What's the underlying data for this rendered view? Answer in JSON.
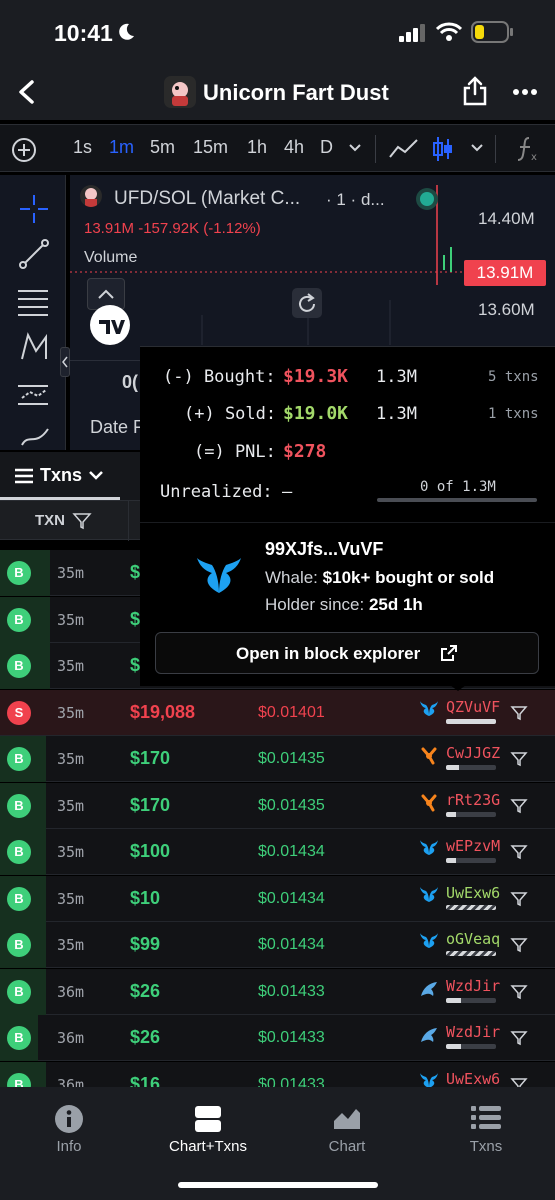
{
  "status_bar": {
    "time": "10:41"
  },
  "header": {
    "title": "Unicorn Fart Dust"
  },
  "toolbar": {
    "timeframes": [
      "1s",
      "1m",
      "5m",
      "15m",
      "1h",
      "4h",
      "D"
    ],
    "active_timeframe": "1m"
  },
  "chart": {
    "symbol": "UFD/SOL (Market C...",
    "interval": "· 1 · d...",
    "price_line": "13.91M  -157.92K (-1.12%)",
    "volume_label": "Volume",
    "axis_ticks": [
      "14.40M",
      "13.60M"
    ],
    "current_price_tag": "13.91M",
    "partial_left_text": "0(",
    "partial_date_text": "Date F"
  },
  "txns": {
    "dropdown_label": "Txns",
    "column_header": "TXN"
  },
  "popup": {
    "bought_label": "(-) Bought:",
    "bought_usd": "$19.3K",
    "bought_tokens": "1.3M",
    "bought_txns": "5 txns",
    "sold_label": "(+) Sold:",
    "sold_usd": "$19.0K",
    "sold_tokens": "1.3M",
    "sold_txns": "1 txns",
    "pnl_label": "(=) PNL:",
    "pnl_value": "$278",
    "unrealized_label": "Unrealized:",
    "unrealized_value": "–",
    "unrealized_count": "0 of 1.3M",
    "wallet": "99XJfs...VuVF",
    "whale_label": "Whale:",
    "whale_value": "$10k+ bought or sold",
    "holder_label": "Holder since:",
    "holder_value": "25d 1h",
    "explorer_button": "Open in block explorer"
  },
  "rows": [
    {
      "type": "B",
      "age": "35m",
      "usd": "$",
      "price": "",
      "maker": "",
      "icon": "",
      "bar": 0,
      "dashed": false
    },
    {
      "type": "B",
      "age": "35m",
      "usd": "$",
      "price": "",
      "maker": "",
      "icon": "",
      "bar": 0,
      "dashed": false
    },
    {
      "type": "B",
      "age": "35m",
      "usd": "$",
      "price": "",
      "maker": "",
      "icon": "",
      "bar": 0,
      "dashed": false
    },
    {
      "type": "S",
      "age": "35m",
      "usd": "$19,088",
      "price": "$0.01401",
      "maker": "QZVuVF",
      "icon": "whale",
      "bar": 1.0,
      "dashed": false
    },
    {
      "type": "B",
      "age": "35m",
      "usd": "$170",
      "price": "$0.01435",
      "maker": "CwJJGZ",
      "icon": "shrimp",
      "bar": 0.25,
      "dashed": false
    },
    {
      "type": "B",
      "age": "35m",
      "usd": "$170",
      "price": "$0.01435",
      "maker": "rRt23G",
      "icon": "shrimp",
      "bar": 0.2,
      "dashed": false
    },
    {
      "type": "B",
      "age": "35m",
      "usd": "$100",
      "price": "$0.01434",
      "maker": "wEPzvM",
      "icon": "whale",
      "bar": 0.2,
      "dashed": false
    },
    {
      "type": "B",
      "age": "35m",
      "usd": "$10",
      "price": "$0.01434",
      "maker": "UwExw6",
      "icon": "whale",
      "bar": 0,
      "dashed": true
    },
    {
      "type": "B",
      "age": "35m",
      "usd": "$99",
      "price": "$0.01434",
      "maker": "oGVeaq",
      "icon": "whale",
      "bar": 0,
      "dashed": true
    },
    {
      "type": "B",
      "age": "36m",
      "usd": "$26",
      "price": "$0.01433",
      "maker": "WzdJir",
      "icon": "dolphin",
      "bar": 0.3,
      "dashed": false
    },
    {
      "type": "B",
      "age": "36m",
      "usd": "$26",
      "price": "$0.01433",
      "maker": "WzdJir",
      "icon": "dolphin",
      "bar": 0.3,
      "dashed": false
    },
    {
      "type": "B",
      "age": "36m",
      "usd": "$16",
      "price": "$0.01433",
      "maker": "UwExw6",
      "icon": "whale",
      "bar": 0,
      "dashed": false
    }
  ],
  "bottom_nav": {
    "items": [
      "Info",
      "Chart+Txns",
      "Chart",
      "Txns"
    ],
    "active": "Chart+Txns"
  },
  "colors": {
    "buy_green": "#3ecf7a",
    "sell_red": "#f0424e",
    "maker_red": "#f0535e",
    "maker_green": "#a3d96a",
    "accent_blue": "#2962ff",
    "whale_blue": "#1da1f2",
    "shrimp_orange": "#f7841c"
  }
}
